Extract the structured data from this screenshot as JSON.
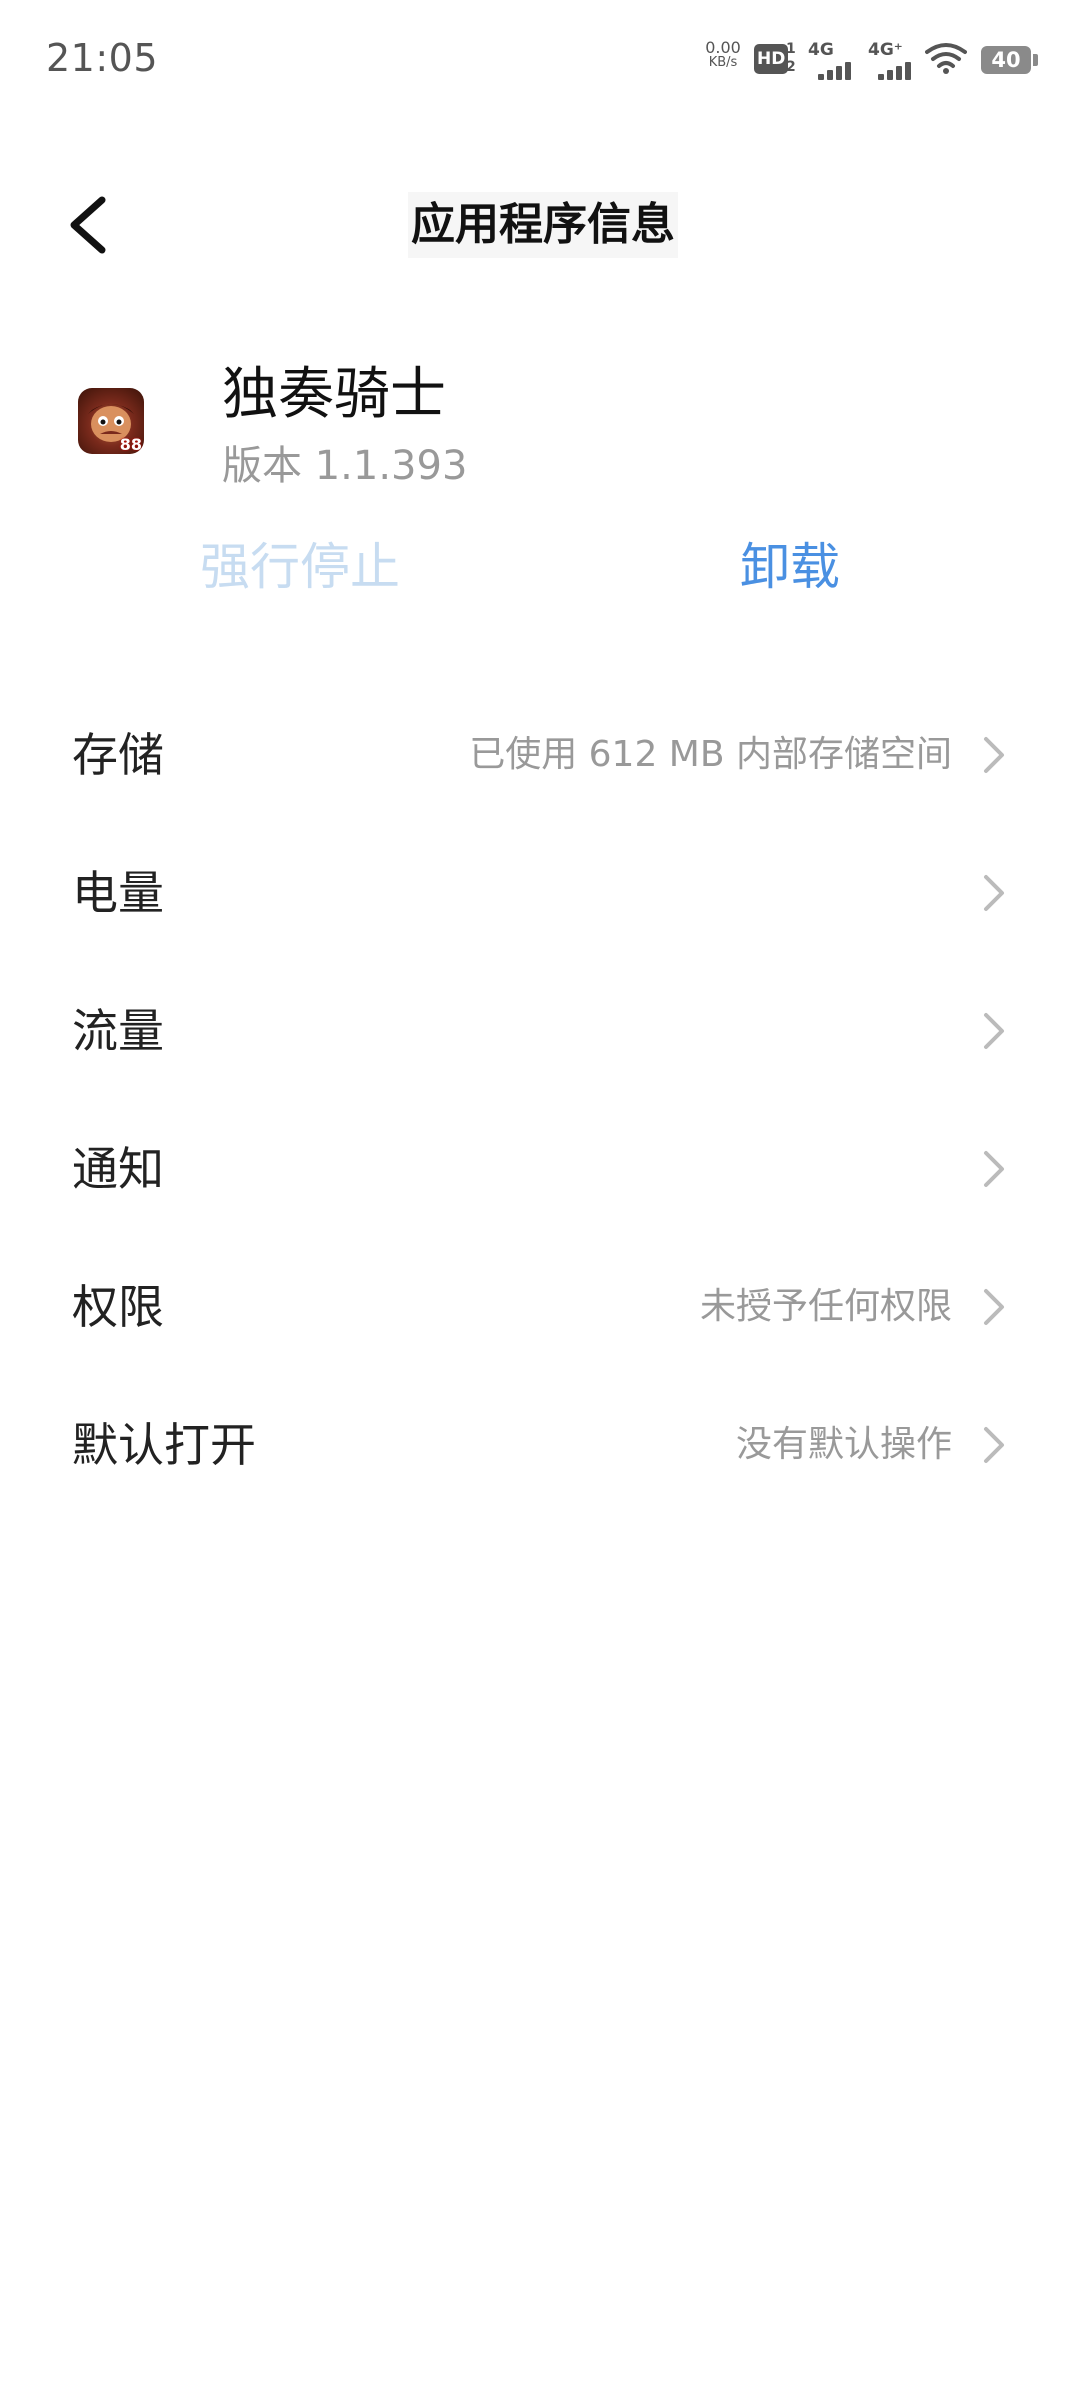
{
  "status_bar": {
    "time": "21:05",
    "net_speed_value": "0.00",
    "net_speed_unit": "KB/s",
    "hd_label": "HD",
    "hd_sub_top": "1",
    "hd_sub_bottom": "2",
    "sim1_label": "4G",
    "sim2_label": "4G⁺",
    "battery_level": "40",
    "icons": [
      "hd-icon",
      "signal-icon",
      "signal-icon",
      "wifi-icon",
      "battery-icon"
    ]
  },
  "header": {
    "back_icon": "chevron-left-icon",
    "title": "应用程序信息"
  },
  "app": {
    "name": "独奏骑士",
    "version": "版本 1.1.393",
    "icon_badge": "88"
  },
  "actions": {
    "force_stop": "强行停止",
    "uninstall": "卸载"
  },
  "settings": [
    {
      "label": "存储",
      "value": "已使用 612 MB 内部存储空间"
    },
    {
      "label": "电量",
      "value": ""
    },
    {
      "label": "流量",
      "value": ""
    },
    {
      "label": "通知",
      "value": ""
    },
    {
      "label": "权限",
      "value": "未授予任何权限"
    },
    {
      "label": "默认打开",
      "value": "没有默认操作"
    }
  ],
  "colors": {
    "accent": "#4a90e2",
    "disabled_accent": "#c7dcf1",
    "secondary_text": "#999999"
  }
}
